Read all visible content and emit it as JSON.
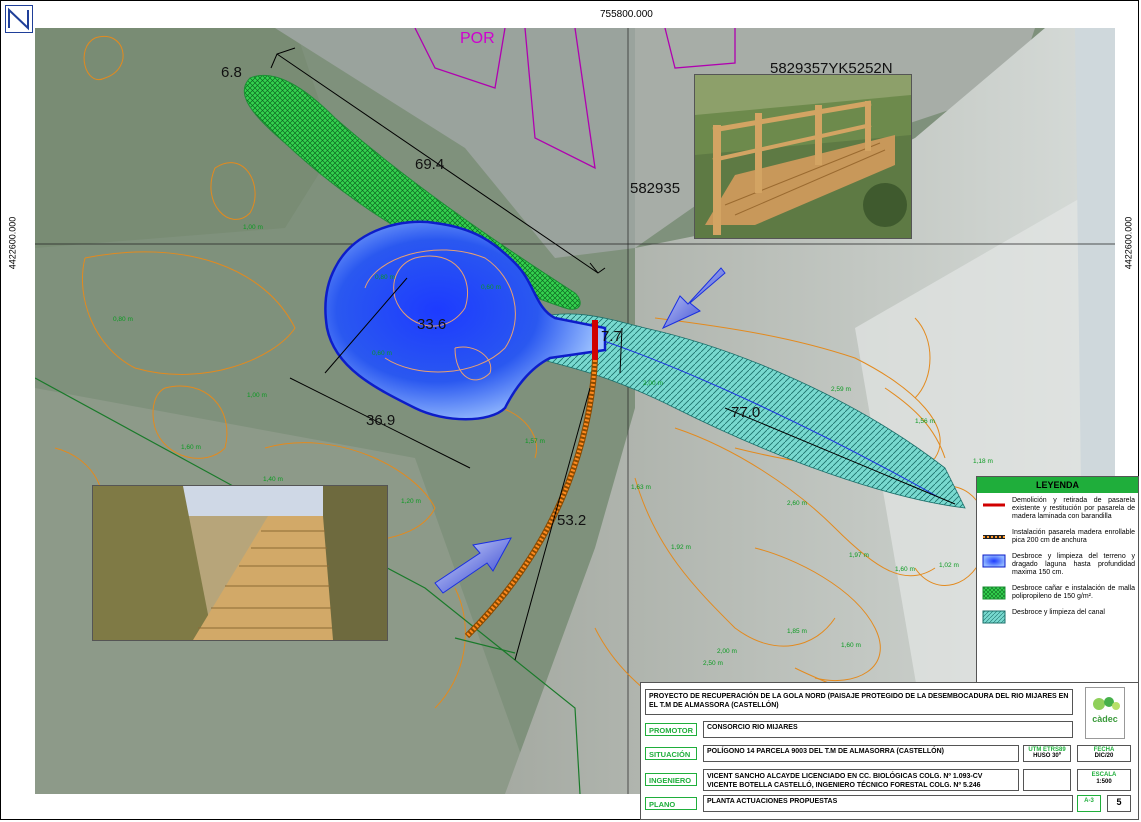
{
  "coordinates": {
    "easting_top": "755800.000",
    "northing_left": "4422600.000",
    "northing_right": "4422600.000"
  },
  "map_labels": {
    "por": "POR",
    "parcel_1": "5829357YK5252N",
    "parcel_2": "582935",
    "m_6_8": "6.8",
    "m_69_4": "69.4",
    "m_33_6": "33.6",
    "m_36_9": "36.9",
    "m_7_7": "7.7",
    "m_77_0": "77.0",
    "m_53_2": "53.2",
    "spot_heights": [
      "1,00 m",
      "0,80 m",
      "1,00 m",
      "1,60 m",
      "1,20 m",
      "1,57 m",
      "1,63 m",
      "1,92 m",
      "2,60 m",
      "1,97 m",
      "1,60 m",
      "1,02 m",
      "1,85 m",
      "1,60 m",
      "2,00 m",
      "2,50 m",
      "1,56 m",
      "1,18 m",
      "2,59 m",
      "1,40 m",
      "0,80 m",
      "0,60 m",
      "0,60 m",
      "2,00 m"
    ]
  },
  "legend": {
    "title": "LEYENDA",
    "items": [
      {
        "symbol": "red-line",
        "text": "Demolición y retirada de pasarela existente y restitución por pasarela de madera laminada con barandilla"
      },
      {
        "symbol": "boardwalk-line",
        "text": "Instalación pasarela madera enrollable pica 200 cm de anchura"
      },
      {
        "symbol": "blue-fill",
        "text": "Desbroce y limpieza del terreno y dragado laguna hasta profundidad maxima 150 cm."
      },
      {
        "symbol": "green-hatch",
        "text": "Desbroce cañar e instalación de malla polipropileno de 150 g/m²."
      },
      {
        "symbol": "teal-hatch",
        "text": "Desbroce y limpieza del canal"
      }
    ]
  },
  "title_block": {
    "project": "PROYECTO DE RECUPERACIÓN DE LA GOLA NORD (PAISAJE PROTEGIDO DE LA DESEMBOCADURA DEL RIO MIJARES EN EL T.M DE ALMASSORA (CASTELLÓN)",
    "logo_text": "càdec",
    "promotor_label": "PROMOTOR",
    "promotor_value": "CONSORCIO RIO MIJARES",
    "situacion_label": "SITUACIÓN",
    "situacion_value": "POLÍGONO 14 PARCELA 9003 DEL T.M DE ALMASORRA (CASTELLÓN)",
    "utm_label": "UTM ETRS89",
    "utm_value": "HUSO 30º",
    "fecha_label": "FECHA",
    "fecha_value": "DIC/20",
    "ingeniero_label": "INGENIERO",
    "ingeniero_line1": "VICENT SANCHO ALCAYDE LICENCIADO EN CC. BIOLÓGICAS COLG. Nº 1.093-CV",
    "ingeniero_line2": "VICENTE BOTELLA CASTELLÓ, INGENIERO TÉCNICO FORESTAL COLG. Nº 5.246",
    "escala_label": "ESCALA",
    "escala_value": "1:500",
    "plano_label": "PLANO",
    "plano_value": "PLANTA ACTUACIONES PROPUESTAS",
    "sheet_size": "A-3",
    "sheet_number": "5"
  },
  "colors": {
    "lagoon": "#1a2fe0",
    "hatch_green": "#2fd04a",
    "channel_teal": "#5fd6c8",
    "contour": "#e38a1e",
    "boundary": "#1a7a2a",
    "parcel": "#b000b0",
    "legend_header": "#1fae3b"
  }
}
